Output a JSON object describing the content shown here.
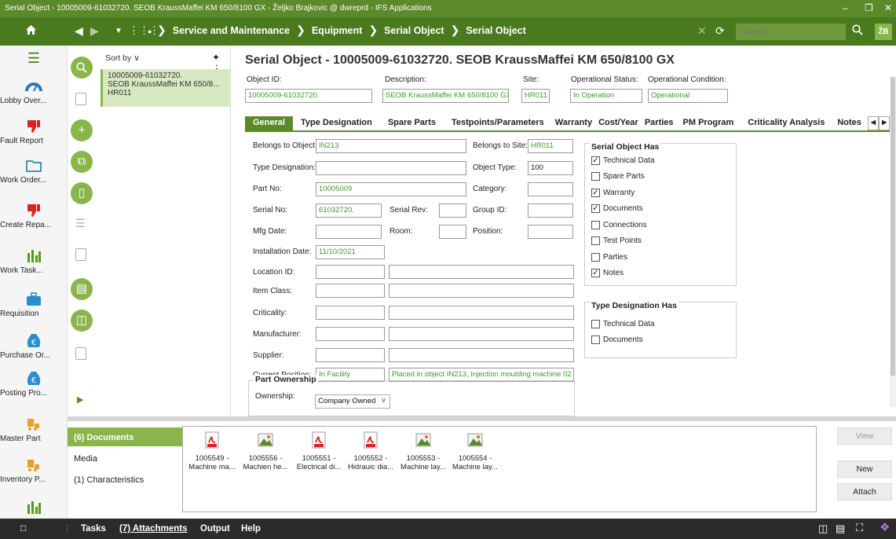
{
  "window": {
    "title": "Serial Object - 10005009-61032720. SEOB KraussMaffei KM 650/8100 GX - Željko Brajkovic @ dwreprd - IFS Applications"
  },
  "nav": {
    "breadcrumbs": [
      "Service and Maintenance",
      "Equipment",
      "Serial Object",
      "Serial Object"
    ],
    "search_placeholder": "Search...",
    "avatar": "ŽB"
  },
  "sidebar": {
    "items": [
      {
        "label": "Lobby Over...",
        "icon": "gauge-icon"
      },
      {
        "label": "Fault Report",
        "icon": "thumbs-down-icon"
      },
      {
        "label": "Work Order...",
        "icon": "folder-icon"
      },
      {
        "label": "Create Repa...",
        "icon": "thumbs-down-icon"
      },
      {
        "label": "Work Task...",
        "icon": "bar-chart-icon"
      },
      {
        "label": "Requisition",
        "icon": "briefcase-icon"
      },
      {
        "label": "Purchase Or...",
        "icon": "euro-bag-icon"
      },
      {
        "label": "Posting Pro...",
        "icon": "euro-bag-icon"
      },
      {
        "label": "Master Part",
        "icon": "forklift-icon"
      },
      {
        "label": "Inventory P...",
        "icon": "forklift-icon"
      }
    ]
  },
  "list": {
    "sort_label": "Sort by",
    "selected": {
      "line1": "10005009-61032720.",
      "line2": "SEOB KraussMaffei KM 650/8...",
      "line3": "HR011"
    }
  },
  "form": {
    "title": "Serial Object - 10005009-61032720. SEOB KraussMaffei KM 650/8100 GX",
    "header": {
      "object_id_label": "Object ID:",
      "object_id": "10005009-61032720.",
      "description_label": "Description:",
      "description": "SEOB KraussMaffei KM 650/8100 GX",
      "site_label": "Site:",
      "site": "HR011",
      "op_status_label": "Operational Status:",
      "op_status": "In Operation",
      "op_condition_label": "Operational Condition:",
      "op_condition": "Operational"
    },
    "tabs": [
      "General",
      "Type Designation",
      "Spare Parts",
      "Testpoints/Parameters",
      "Warranty",
      "Cost/Year",
      "Parties",
      "PM Program",
      "Criticality Analysis",
      "Notes"
    ],
    "fields": {
      "belongs_to_object_label": "Belongs to Object:",
      "belongs_to_object": "IN213",
      "belongs_to_site_label": "Belongs to Site:",
      "belongs_to_site": "HR011",
      "type_designation_label": "Type Designation:",
      "type_designation": "",
      "object_type_label": "Object Type:",
      "object_type": "100",
      "part_no_label": "Part No:",
      "part_no": "10005009",
      "category_label": "Category:",
      "serial_no_label": "Serial No:",
      "serial_no": "61032720.",
      "serial_rev_label": "Serial Rev:",
      "group_id_label": "Group ID:",
      "mfg_date_label": "Mfg Date:",
      "room_label": "Room:",
      "position_label": "Position:",
      "installation_date_label": "Installation Date:",
      "installation_date": "11/10/2021",
      "location_id_label": "Location ID:",
      "item_class_label": "Item Class:",
      "criticality_label": "Criticality:",
      "manufacturer_label": "Manufacturer:",
      "supplier_label": "Supplier:",
      "current_position_label": "Current Position:",
      "current_position": "In Facility",
      "current_position_desc": "Placed in object IN213, Injection moulding machine 02"
    },
    "serial_object_has": {
      "title": "Serial Object Has",
      "items": [
        {
          "label": "Technical Data",
          "checked": true
        },
        {
          "label": "Spare Parts",
          "checked": false
        },
        {
          "label": "Warranty",
          "checked": true
        },
        {
          "label": "Documents",
          "checked": true
        },
        {
          "label": "Connections",
          "checked": false
        },
        {
          "label": "Test Points",
          "checked": false
        },
        {
          "label": "Parties",
          "checked": false
        },
        {
          "label": "Notes",
          "checked": true
        }
      ]
    },
    "type_designation_has": {
      "title": "Type Designation Has",
      "items": [
        {
          "label": "Technical Data",
          "checked": false
        },
        {
          "label": "Documents",
          "checked": false
        }
      ]
    },
    "part_ownership": {
      "title": "Part Ownership",
      "ownership_label": "Ownership:",
      "ownership": "Company Owned"
    }
  },
  "bottom": {
    "nav": [
      "(6) Documents",
      "Media",
      "(1) Characteristics"
    ],
    "docs": [
      {
        "type": "pdf",
        "line1": "1005549 -",
        "line2": "Machine ma..."
      },
      {
        "type": "image",
        "line1": "1005556 -",
        "line2": "Machien he..."
      },
      {
        "type": "pdf",
        "line1": "1005551 -",
        "line2": "Electrical di..."
      },
      {
        "type": "pdf",
        "line1": "1005552 -",
        "line2": "Hidrauic dia..."
      },
      {
        "type": "image",
        "line1": "1005553 -",
        "line2": "Machine lay..."
      },
      {
        "type": "image",
        "line1": "1005554 -",
        "line2": "Machine lay..."
      }
    ],
    "buttons": {
      "view": "View",
      "new": "New",
      "attach": "Attach"
    }
  },
  "statusbar": {
    "tasks": "Tasks",
    "attachments": "(7) Attachments",
    "output": "Output",
    "help": "Help"
  },
  "colors": {
    "brand": "#5b8a2a",
    "accent": "#8ab54b",
    "value_text": "#3a9a2a"
  }
}
